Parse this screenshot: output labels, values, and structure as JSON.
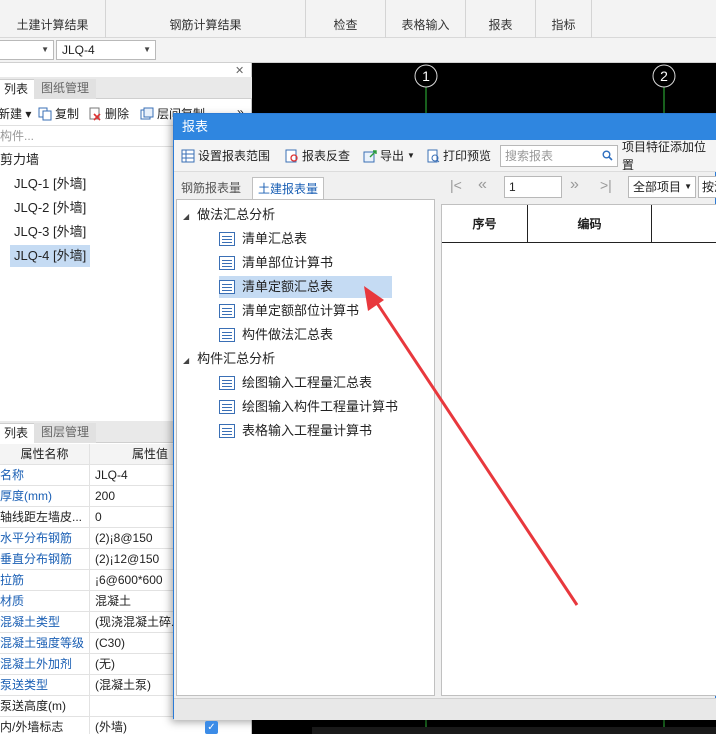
{
  "ribbon": {
    "tabs": [
      "土建计算结果",
      "钢筋计算结果",
      "检查",
      "表格输入",
      "报表",
      "指标"
    ]
  },
  "selectors": {
    "first_value": "",
    "component_value": "JLQ-4"
  },
  "left_panel": {
    "top_tabs": [
      "列表",
      "图纸管理"
    ],
    "toolbar": {
      "new": "新建",
      "copy": "复制",
      "delete": "删除",
      "floor_copy": "层间复制"
    },
    "search_placeholder": "构件...",
    "tree_root": "剪力墙",
    "tree_items": [
      {
        "label": "JLQ-1 [外墙]"
      },
      {
        "label": "JLQ-2 [外墙]"
      },
      {
        "label": "JLQ-3 [外墙]"
      },
      {
        "label": "JLQ-4 [外墙]"
      }
    ],
    "bottom_tabs": [
      "列表",
      "图层管理"
    ],
    "prop_headers": {
      "name": "属性名称",
      "value": "属性值"
    },
    "properties": [
      {
        "name": "名称",
        "value": "JLQ-4",
        "blue": true
      },
      {
        "name": "厚度(mm)",
        "value": "200",
        "blue": true
      },
      {
        "name": "轴线距左墙皮...",
        "value": "0",
        "blue": false
      },
      {
        "name": "水平分布钢筋",
        "value": "(2)¡8@150",
        "blue": true
      },
      {
        "name": "垂直分布钢筋",
        "value": "(2)¡12@150",
        "blue": true
      },
      {
        "name": "拉筋",
        "value": "¡6@600*600",
        "blue": true
      },
      {
        "name": "材质",
        "value": "混凝土",
        "blue": true
      },
      {
        "name": "混凝土类型",
        "value": "(现浇混凝土碎...",
        "blue": true
      },
      {
        "name": "混凝土强度等级",
        "value": "(C30)",
        "blue": true
      },
      {
        "name": "混凝土外加剂",
        "value": "(无)",
        "blue": true
      },
      {
        "name": "泵送类型",
        "value": "(混凝土泵)",
        "blue": true
      },
      {
        "name": "泵送高度(m)",
        "value": "",
        "blue": false
      },
      {
        "name": "内/外墙标志",
        "value": "(外墙)",
        "blue": false
      }
    ]
  },
  "canvas": {
    "axis_labels": [
      "1",
      "2"
    ]
  },
  "dialog": {
    "title": "报表",
    "toolbar": {
      "set_range": "设置报表范围",
      "report_check": "报表反查",
      "export": "导出",
      "print_preview": "打印预览",
      "search_placeholder": "搜索报表",
      "item_feature": "项目特征添加位置"
    },
    "tabs": [
      "钢筋报表量",
      "土建报表量"
    ],
    "groups": [
      {
        "label": "做法汇总分析",
        "items": [
          "清单汇总表",
          "清单部位计算书",
          "清单定额汇总表",
          "清单定额部位计算书",
          "构件做法汇总表"
        ]
      },
      {
        "label": "构件汇总分析",
        "items": [
          "绘图输入工程量汇总表",
          "绘图输入构件工程量计算书",
          "表格输入工程量计算书"
        ]
      }
    ],
    "pager": {
      "page": "1",
      "filter": "全部项目",
      "filter2": "按清"
    },
    "grid_headers": [
      "序号",
      "编码",
      ""
    ]
  },
  "colors": {
    "accent": "#2f86e0",
    "selection": "#c5dbf3",
    "arrow": "#e8383d",
    "axis": "#2fbf3a"
  }
}
